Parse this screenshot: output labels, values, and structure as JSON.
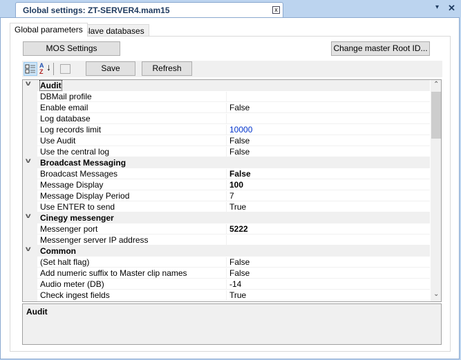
{
  "window": {
    "title": "Global settings: ZT-SERVER4.mam15",
    "close": "x",
    "menu": "▾",
    "win_close": "✕"
  },
  "tabs": [
    {
      "label": "Global parameters",
      "active": true
    },
    {
      "label": "Slave databases",
      "active": false
    }
  ],
  "buttons": {
    "mos": "MOS Settings",
    "change_root": "Change master Root ID...",
    "save": "Save",
    "refresh": "Refresh"
  },
  "toolbar_icons": [
    "categorized-icon",
    "alphabetical-sort-icon",
    "property-pages-icon"
  ],
  "grid": {
    "categories": [
      {
        "name": "Audit",
        "props": [
          [
            "DBMail profile",
            ""
          ],
          [
            "Enable email",
            "False"
          ],
          [
            "Log database",
            ""
          ],
          [
            "Log records limit",
            "10000"
          ],
          [
            "Use Audit",
            "False"
          ],
          [
            "Use the central log",
            "False"
          ]
        ]
      },
      {
        "name": "Broadcast Messaging",
        "props": [
          [
            "Broadcast Messages",
            "False"
          ],
          [
            "Message Display",
            "100"
          ],
          [
            "Message Display Period",
            "7"
          ],
          [
            "Use ENTER to send",
            "True"
          ]
        ]
      },
      {
        "name": "Cinegy messenger",
        "props": [
          [
            "Messenger port",
            "5222"
          ],
          [
            "Messenger server IP address",
            ""
          ]
        ]
      },
      {
        "name": "Common",
        "props": [
          [
            "(Set halt flag)",
            "False"
          ],
          [
            "Add numeric suffix to Master clip names",
            "False"
          ],
          [
            "Audio meter (DB)",
            "-14"
          ],
          [
            "Check ingest fields",
            "True"
          ]
        ]
      }
    ],
    "bold_values": [
      "Broadcast Messages",
      "Message Display",
      "Messenger port"
    ],
    "blue_values": [
      "Log records limit"
    ],
    "selected_category": "Audit"
  },
  "description": {
    "title": "Audit"
  },
  "colors": {
    "accent": "#bcd4ef",
    "category_bg": "#f0f0f0",
    "blue_value": "#0033cc"
  }
}
